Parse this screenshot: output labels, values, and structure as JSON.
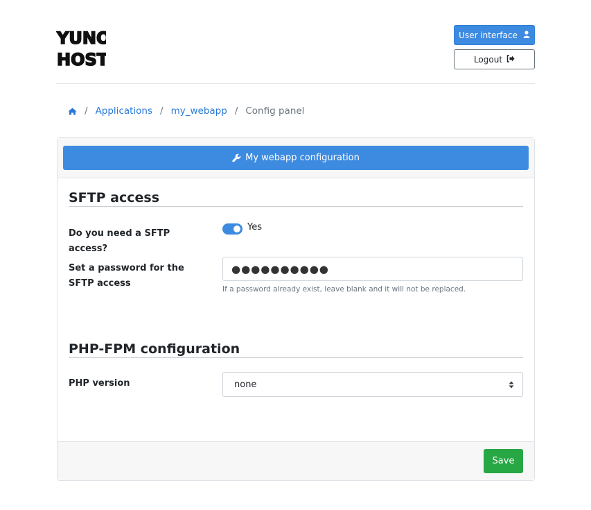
{
  "header": {
    "logo_lines": [
      "YUNO",
      "HOST"
    ],
    "user_interface_label": "User interface",
    "logout_label": "Logout"
  },
  "breadcrumb": {
    "separator": "/",
    "items": [
      "Applications",
      "my_webapp"
    ],
    "current": "Config panel"
  },
  "panel": {
    "header_button": "My webapp configuration",
    "sections": [
      {
        "title": "SFTP access",
        "fields": [
          {
            "label": "Do you need a SFTP access?",
            "toggle_state": "Yes"
          },
          {
            "label": "Set a password for the SFTP access",
            "value": "●●●●●●●●●●",
            "help": "If a password already exist, leave blank and it will not be replaced."
          }
        ]
      },
      {
        "title": "PHP-FPM configuration",
        "fields": [
          {
            "label": "PHP version",
            "selected": "none"
          }
        ]
      }
    ],
    "save_label": "Save"
  },
  "colors": {
    "primary": "#3d8be0",
    "success": "#28a745",
    "link": "#2b7ad7"
  }
}
